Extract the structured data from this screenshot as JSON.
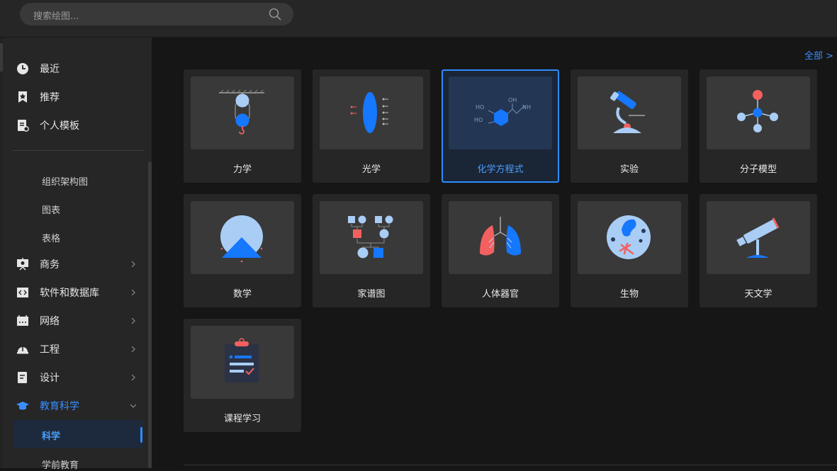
{
  "search": {
    "placeholder": "搜索绘图..."
  },
  "sidebar": {
    "items": [
      {
        "label": "最近",
        "icon": "clock-icon"
      },
      {
        "label": "推荐",
        "icon": "star-bookmark-icon"
      },
      {
        "label": "个人模板",
        "icon": "personal-template-icon"
      }
    ],
    "sub_items": [
      "组织架构图",
      "图表",
      "表格"
    ],
    "categories": [
      {
        "label": "商务",
        "icon": "presentation-icon"
      },
      {
        "label": "软件和数据库",
        "icon": "code-icon"
      },
      {
        "label": "网络",
        "icon": "network-icon"
      },
      {
        "label": "工程",
        "icon": "helmet-icon"
      },
      {
        "label": "设计",
        "icon": "design-doc-icon"
      },
      {
        "label": "教育科学",
        "icon": "graduation-cap-icon"
      }
    ],
    "active_sub": "科学",
    "next_sub": "学前教育"
  },
  "main": {
    "all_link": "全部  >",
    "cards": [
      {
        "label": "力学",
        "icon": "mechanics-icon"
      },
      {
        "label": "光学",
        "icon": "optics-icon"
      },
      {
        "label": "化学方程式",
        "icon": "chemical-equation-icon",
        "selected": true
      },
      {
        "label": "实验",
        "icon": "microscope-icon"
      },
      {
        "label": "分子模型",
        "icon": "molecule-icon"
      },
      {
        "label": "数学",
        "icon": "math-icon"
      },
      {
        "label": "家谱图",
        "icon": "family-tree-icon"
      },
      {
        "label": "人体器官",
        "icon": "lungs-icon"
      },
      {
        "label": "生物",
        "icon": "cell-icon"
      },
      {
        "label": "天文学",
        "icon": "telescope-icon"
      },
      {
        "label": "课程学习",
        "icon": "clipboard-icon"
      }
    ]
  },
  "colors": {
    "accent": "#2e8cff",
    "blue": "#1677ff",
    "light_blue": "#a9cdf5",
    "red": "#f2615f"
  }
}
